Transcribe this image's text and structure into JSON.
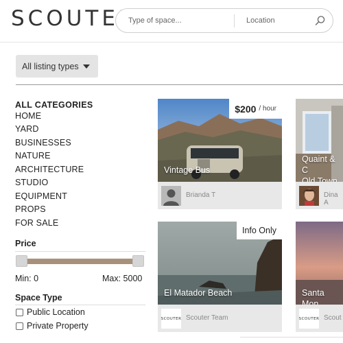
{
  "header": {
    "logo": "SCOUTER",
    "search_placeholder": "Type of space...",
    "location_placeholder": "Location",
    "search_icon": "search-icon"
  },
  "filter": {
    "listing_type_label": "All listing types",
    "caret_icon": "caret-down-icon"
  },
  "sidebar": {
    "categories_heading": "ALL CATEGORIES",
    "categories": [
      "HOME",
      "YARD",
      "BUSINESSES",
      "NATURE",
      "ARCHITECTURE",
      "STUDIO",
      "EQUIPMENT",
      "PROPS",
      "FOR SALE"
    ],
    "price": {
      "heading": "Price",
      "min_label": "Min: 0",
      "max_label": "Max: 5000",
      "min_value": 0,
      "max_value": 5000
    },
    "space_type": {
      "heading": "Space Type",
      "options": [
        {
          "label": "Public Location",
          "checked": false
        },
        {
          "label": "Private Property",
          "checked": false
        }
      ]
    }
  },
  "listings": [
    {
      "title": "Vintage Bus",
      "price": "$200",
      "unit": "/ hour",
      "owner": "Brianda T"
    },
    {
      "title_line1": "Quaint & C",
      "title_line2": "Old Town S",
      "owner": "Dina A"
    },
    {
      "title": "El Matador Beach",
      "tag": "Info Only",
      "owner": "Scouter Team",
      "badge": "SCOUTER"
    },
    {
      "title": "Santa Mon",
      "owner": "Scout",
      "badge": "SCOUTER"
    }
  ],
  "colors": {
    "slider_fill": "#a8917b",
    "filter_bg": "#e4e4e4",
    "card_footer_bg": "#e8e8e8"
  }
}
